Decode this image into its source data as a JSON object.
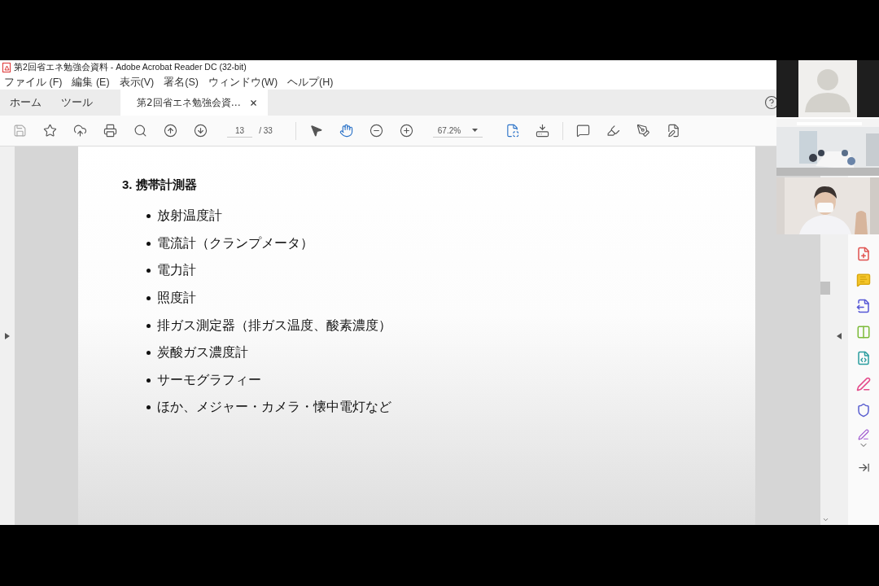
{
  "window": {
    "title": "第2回省エネ勉強会資料 - Adobe Acrobat Reader DC (32-bit)"
  },
  "menu": [
    "ファイル (F)",
    "編集 (E)",
    "表示(V)",
    "署名(S)",
    "ウィンドウ(W)",
    "ヘルプ(H)"
  ],
  "tabs": [
    {
      "label": "ホーム",
      "selected": false
    },
    {
      "label": "ツール",
      "selected": false
    },
    {
      "label": "第2回省エネ勉強会資…",
      "selected": true
    }
  ],
  "toolbar": {
    "page": "13",
    "total": "/  33",
    "zoom": "67.2%"
  },
  "document": {
    "heading": "3. 携帯計測器",
    "items": [
      "放射温度計",
      "電流計（クランプメータ）",
      "電力計",
      "照度計",
      "排ガス測定器（排ガス温度、酸素濃度）",
      "炭酸ガス濃度計",
      "サーモグラフィー",
      "ほか、メジャー・カメラ・懐中電灯など"
    ]
  },
  "participants": [
    {
      "kind": "avatar"
    },
    {
      "kind": "picture"
    },
    {
      "kind": "picture"
    }
  ]
}
